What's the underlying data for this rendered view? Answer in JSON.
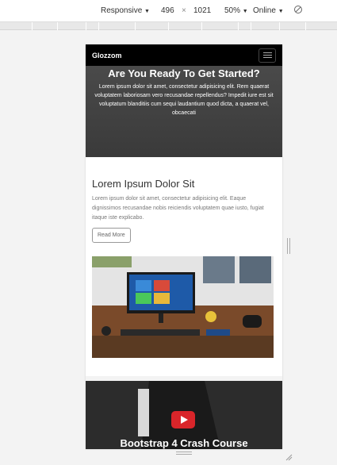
{
  "devtools": {
    "device_label": "Responsive",
    "width_value": "496",
    "times_sign": "×",
    "height_value": "1021",
    "zoom_label": "50%",
    "network_label": "Online",
    "caret": "▼",
    "rotate_icon": "rotate-icon"
  },
  "page": {
    "brand": "Glozzom",
    "hero": {
      "title": "Are You Ready To Get Started?",
      "body": "Lorem ipsum dolor sit amet, consectetur adipisicing elit. Rem quaerat voluptatem laboriosam vero recusandae repellendus? Impedit iure est sit voluptatum blanditiis cum sequi laudantium quod dicta, a quaerat vel, obcaecati"
    },
    "article": {
      "title": "Lorem Ipsum Dolor Sit",
      "body": "Lorem ipsum dolor sit amet, consectetur adipisicing elit. Eaque dignissimos recusandae nobis reiciendis voluptatem quae iusto, fugiat itaque iste explicabo.",
      "button_label": "Read More"
    },
    "video": {
      "title": "Bootstrap 4 Crash Course"
    }
  },
  "colors": {
    "navbar": "#000000",
    "hero_bg": "#444444",
    "play_button": "#d9252a"
  }
}
